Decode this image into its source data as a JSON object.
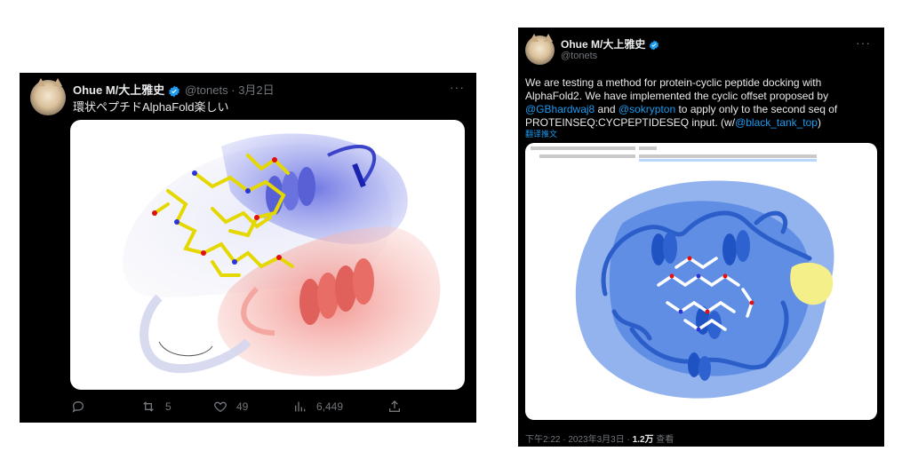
{
  "tweet1": {
    "name": "Ohue M/大上雅史",
    "handle": "@tonets",
    "date": "3月2日",
    "text": "環状ペプチドAlphaFold楽しい",
    "more": "···",
    "actions": {
      "reply_count": "",
      "retweet_count": "5",
      "like_count": "49",
      "view_count": "6,449"
    }
  },
  "tweet2": {
    "name": "Ohue M/大上雅史",
    "handle": "@tonets",
    "more": "···",
    "text_1": "We are testing a method for protein-cyclic peptide docking with AlphaFold2. We have implemented the cyclic offset proposed by ",
    "mention_1": "@GBhardwaj8",
    "text_2": " and ",
    "mention_2": "@sokrypton",
    "text_3": " to apply only to the second seq of PROTEINSEQ:CYCPEPTIDESEQ input. (w/",
    "mention_3": "@black_tank_top",
    "text_4": ")",
    "translate": "翻译推文",
    "time": "下午2:22 · 2023年3月3日 · ",
    "views_count": "1.2万",
    "views_label": " 查看"
  }
}
